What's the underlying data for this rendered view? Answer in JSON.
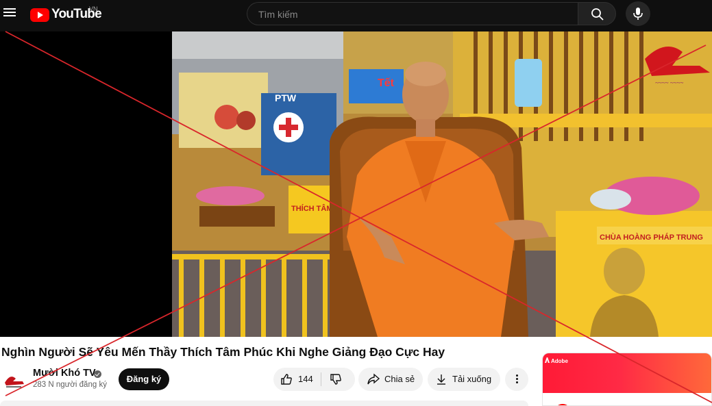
{
  "header": {
    "logo_text": "YouTube",
    "country_code": "VN",
    "search_placeholder": "Tìm kiếm"
  },
  "video": {
    "title": "Nghìn Người Sẽ Yêu Mến Thầy Thích Tâm Phúc Khi Nghe Giảng Đạo Cực Hay",
    "scene_banner_text_1": "THÍCH TÂM PH",
    "scene_banner_text_2": "CHÙA HOÀNG PHÁP TRUNG",
    "scene_sign_1": "PTW",
    "scene_sign_2": "Tết"
  },
  "channel": {
    "name": "Mười Khó TV",
    "subscribers": "283 N người đăng ký",
    "subscribe_label": "Đăng ký"
  },
  "actions": {
    "like_count": "144",
    "share_label": "Chia sẻ",
    "download_label": "Tải xuống"
  },
  "ad": {
    "brand": "Adobe"
  },
  "colors": {
    "masthead": "#0f0f0f",
    "youtube_red": "#ff0000",
    "overlay_x": "#d9262b",
    "robe": "#f07c22"
  }
}
